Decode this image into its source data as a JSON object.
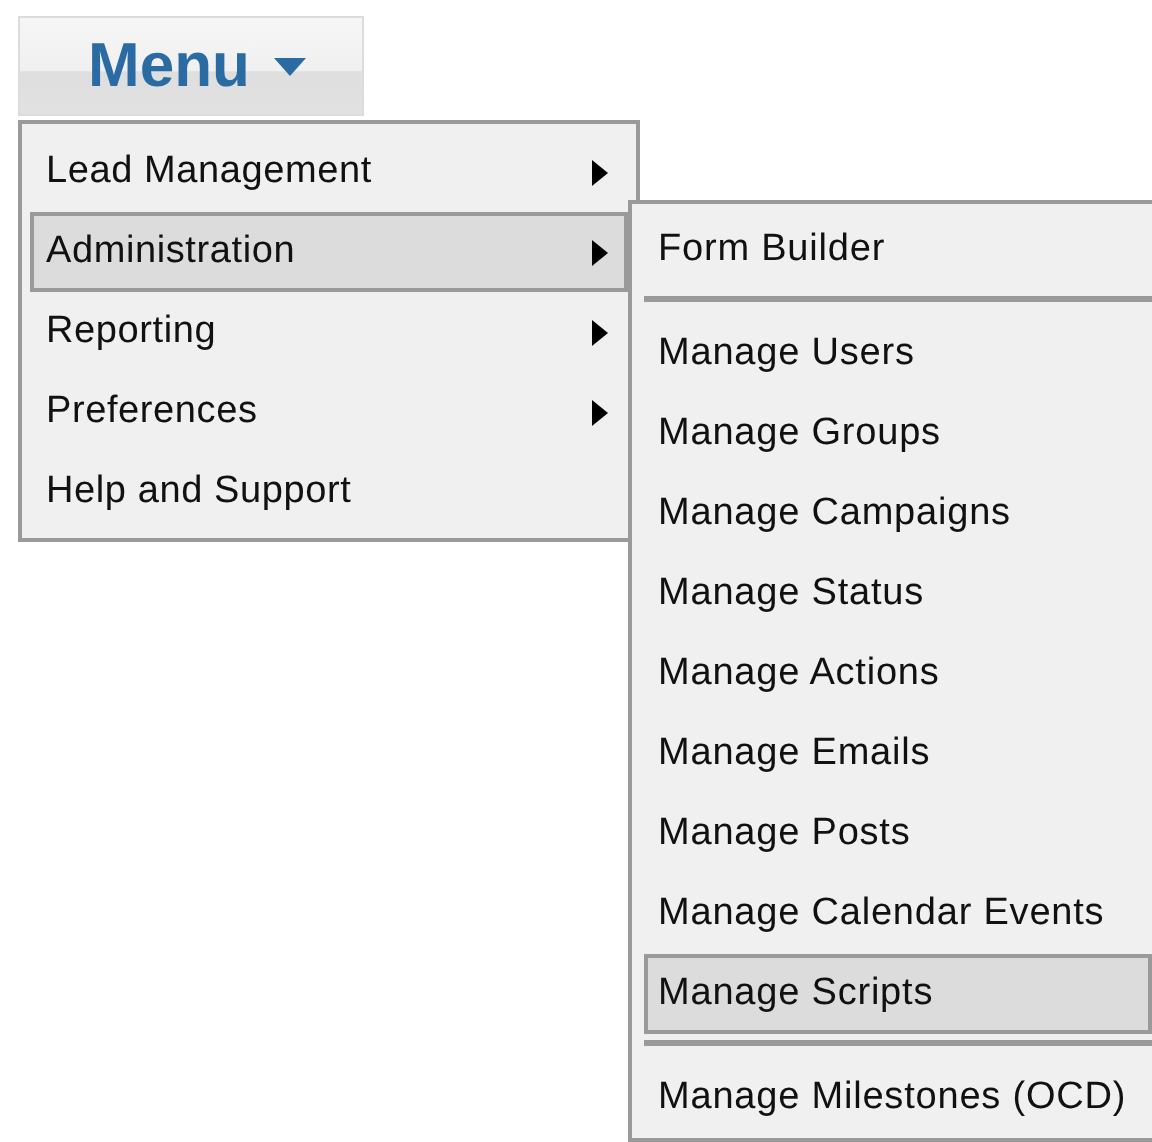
{
  "menu_button": {
    "label": "Menu"
  },
  "menu": {
    "items": [
      {
        "label": "Lead Management",
        "has_submenu": true,
        "selected": false
      },
      {
        "label": "Administration",
        "has_submenu": true,
        "selected": true
      },
      {
        "label": "Reporting",
        "has_submenu": true,
        "selected": false
      },
      {
        "label": "Preferences",
        "has_submenu": true,
        "selected": false
      },
      {
        "label": "Help and Support",
        "has_submenu": false,
        "selected": false
      }
    ]
  },
  "submenu": {
    "items": [
      {
        "kind": "item",
        "label": "Form Builder",
        "selected": false
      },
      {
        "kind": "separator"
      },
      {
        "kind": "item",
        "label": "Manage Users",
        "selected": false
      },
      {
        "kind": "item",
        "label": "Manage Groups",
        "selected": false
      },
      {
        "kind": "item",
        "label": "Manage Campaigns",
        "selected": false
      },
      {
        "kind": "item",
        "label": "Manage Status",
        "selected": false
      },
      {
        "kind": "item",
        "label": "Manage Actions",
        "selected": false
      },
      {
        "kind": "item",
        "label": "Manage Emails",
        "selected": false
      },
      {
        "kind": "item",
        "label": "Manage Posts",
        "selected": false
      },
      {
        "kind": "item",
        "label": "Manage Calendar Events",
        "selected": false
      },
      {
        "kind": "item",
        "label": "Manage Scripts",
        "selected": true
      },
      {
        "kind": "separator"
      },
      {
        "kind": "item",
        "label": "Manage Milestones (OCD)",
        "selected": false
      }
    ]
  }
}
